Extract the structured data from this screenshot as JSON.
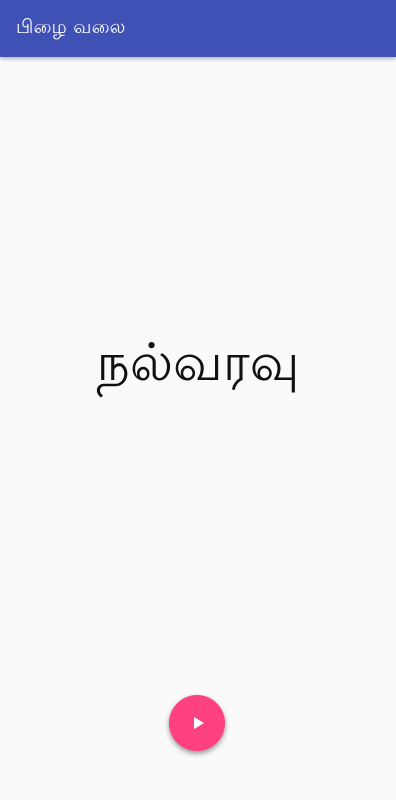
{
  "app_bar": {
    "title": "பிழை வலை",
    "color": "#3f51b5"
  },
  "main": {
    "greeting": "நல்வரவு"
  },
  "fab": {
    "icon": "play-icon",
    "color": "#ff4081"
  }
}
